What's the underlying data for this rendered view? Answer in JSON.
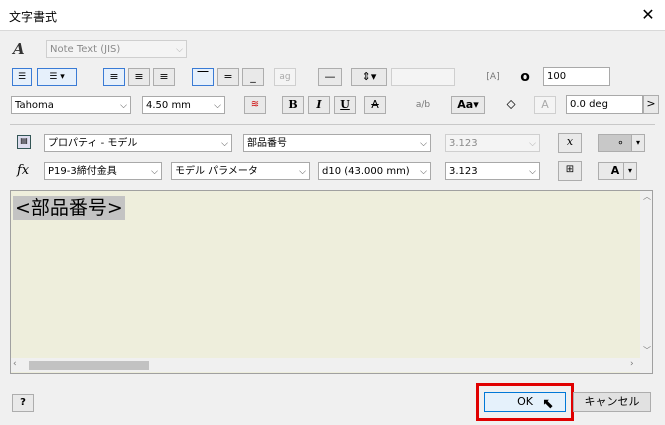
{
  "window": {
    "title": "文字書式",
    "close_label": "✕"
  },
  "row1": {
    "style_select": "Note Text (JIS)"
  },
  "row2": {
    "width_value": "100"
  },
  "row3": {
    "font": "Tahoma",
    "size": "4.50 mm",
    "bold": "B",
    "italic": "I",
    "underline": "U",
    "strike": "A",
    "rotation": "0.0 deg",
    "rotation_more": ">",
    "fill_color_glyph": "A"
  },
  "row4": {
    "type_select": "プロパティ - モデル",
    "property_select": "部品番号",
    "precision_select": "3.123",
    "symbol_dot": "∘",
    "func_label": "x"
  },
  "row5": {
    "part_select": "P19-3締付金具",
    "param_type_select": "モデル パラメータ",
    "param_select": "d10 (43.000 mm)",
    "precision_select": "3.123",
    "text_color": "A",
    "fx_label": "fx"
  },
  "editor": {
    "content": "<部品番号>"
  },
  "footer": {
    "ok_label": "OK",
    "cancel_label": "キャンセル",
    "help_label": "?"
  },
  "colors": {
    "editor_bg": "#eeeedc",
    "highlight": "#e00000",
    "accent": "#0078d7"
  }
}
